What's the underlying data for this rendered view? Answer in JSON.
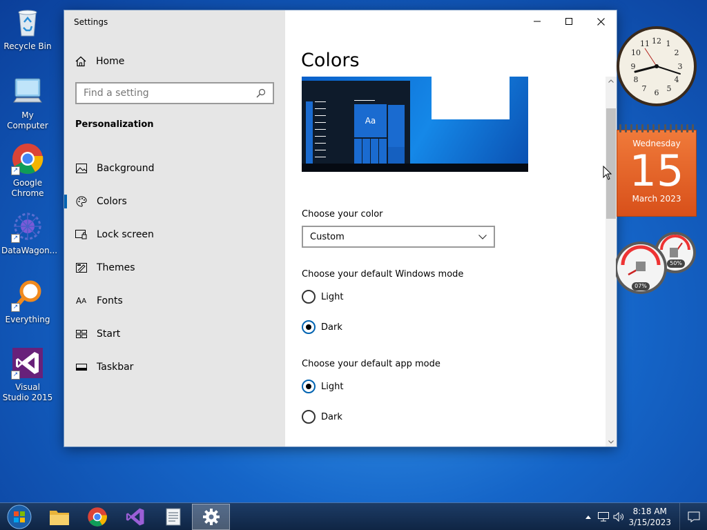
{
  "desktop": {
    "icons": [
      {
        "label": "Recycle Bin",
        "icon": "recycle-bin-icon"
      },
      {
        "label": "My Computer",
        "icon": "computer-icon"
      },
      {
        "label": "Google Chrome",
        "icon": "chrome-icon"
      },
      {
        "label": "DataWagon...",
        "icon": "datawagon-icon"
      },
      {
        "label": "Everything",
        "icon": "search-magnifier-icon"
      },
      {
        "label": "Visual Studio 2015",
        "icon": "visual-studio-icon"
      }
    ]
  },
  "window": {
    "title": "Settings",
    "home_label": "Home",
    "search_placeholder": "Find a setting",
    "section_title": "Personalization",
    "nav_items": [
      {
        "label": "Background",
        "icon": "image-icon"
      },
      {
        "label": "Colors",
        "icon": "palette-icon",
        "active": true
      },
      {
        "label": "Lock screen",
        "icon": "lock-screen-icon"
      },
      {
        "label": "Themes",
        "icon": "themes-icon"
      },
      {
        "label": "Fonts",
        "icon": "fonts-icon"
      },
      {
        "label": "Start",
        "icon": "start-icon"
      },
      {
        "label": "Taskbar",
        "icon": "taskbar-icon"
      }
    ],
    "controls": {
      "minimize": "minimize-icon",
      "maximize": "maximize-icon",
      "close": "close-icon"
    }
  },
  "content": {
    "page_title": "Colors",
    "preview_tile_text": "Aa",
    "choose_color_label": "Choose your color",
    "color_value": "Custom",
    "windows_mode_label": "Choose your default Windows mode",
    "windows_mode_options": [
      "Light",
      "Dark"
    ],
    "windows_mode_selected": "Dark",
    "app_mode_label": "Choose your default app mode",
    "app_mode_options": [
      "Light",
      "Dark"
    ],
    "app_mode_selected": "Light"
  },
  "gadgets": {
    "calendar": {
      "weekday": "Wednesday",
      "day": "15",
      "month_year": "March 2023"
    },
    "meter": {
      "cpu": "07%",
      "memory": "50%"
    }
  },
  "taskbar": {
    "apps": [
      "start-orb-icon",
      "file-explorer-icon",
      "chrome-icon",
      "visual-studio-icon",
      "notepad-icon",
      "settings-gear-icon"
    ],
    "time": "8:18 AM",
    "date": "3/15/2023"
  },
  "colors": {
    "accent": "#0063b1",
    "sidebar_bg": "#e6e6e6",
    "calendar_orange": "#e8642a"
  }
}
